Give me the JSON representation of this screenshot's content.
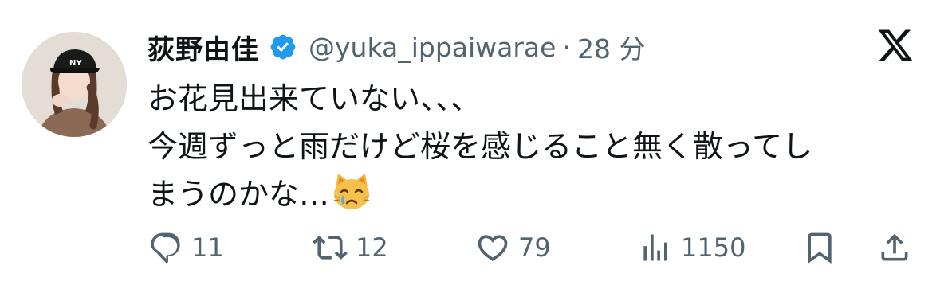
{
  "tweet": {
    "display_name": "荻野由佳",
    "handle": "@yuka_ippaiwarae",
    "separator": "·",
    "timestamp": "28 分",
    "body_lines": [
      "お花見出来ていない、、、",
      "今週ずっと雨だけど桜を感じること無く散ってし",
      "まうのかな…"
    ],
    "emoji": "crying-cat-face"
  },
  "actions": {
    "reply_count": "11",
    "retweet_count": "12",
    "like_count": "79",
    "views_count": "1150"
  },
  "colors": {
    "verified_blue": "#1d9bf0",
    "text_primary": "#0f1419",
    "text_secondary": "#536471"
  },
  "icons": {
    "verified": "verified-badge-icon",
    "platform": "x-logo-icon",
    "reply": "reply-icon",
    "retweet": "retweet-icon",
    "like": "heart-icon",
    "views": "views-icon",
    "bookmark": "bookmark-icon",
    "share": "share-icon"
  }
}
